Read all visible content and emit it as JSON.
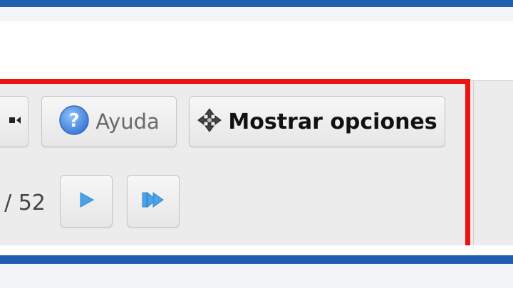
{
  "toolbar": {
    "help_label": "Ayuda",
    "options_label": "Mostrar opciones"
  },
  "pager": {
    "total_text": "/ 52"
  },
  "icons": {
    "help": "help-icon",
    "options": "move-arrows-icon",
    "play": "play-icon",
    "last": "skip-to-end-icon",
    "partial": "rewind-icon"
  },
  "colors": {
    "accent_bar": "#1f5fb0",
    "highlight": "#ee1111",
    "help_icon": "#4a8fe0",
    "play_icon": "#4aa3e8"
  }
}
